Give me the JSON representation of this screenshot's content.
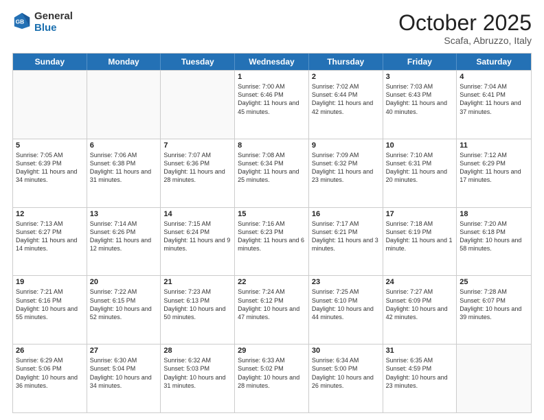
{
  "header": {
    "logo_general": "General",
    "logo_blue": "Blue",
    "month": "October 2025",
    "location": "Scafa, Abruzzo, Italy"
  },
  "weekdays": [
    "Sunday",
    "Monday",
    "Tuesday",
    "Wednesday",
    "Thursday",
    "Friday",
    "Saturday"
  ],
  "rows": [
    [
      {
        "date": "",
        "info": ""
      },
      {
        "date": "",
        "info": ""
      },
      {
        "date": "",
        "info": ""
      },
      {
        "date": "1",
        "info": "Sunrise: 7:00 AM\nSunset: 6:46 PM\nDaylight: 11 hours and 45 minutes."
      },
      {
        "date": "2",
        "info": "Sunrise: 7:02 AM\nSunset: 6:44 PM\nDaylight: 11 hours and 42 minutes."
      },
      {
        "date": "3",
        "info": "Sunrise: 7:03 AM\nSunset: 6:43 PM\nDaylight: 11 hours and 40 minutes."
      },
      {
        "date": "4",
        "info": "Sunrise: 7:04 AM\nSunset: 6:41 PM\nDaylight: 11 hours and 37 minutes."
      }
    ],
    [
      {
        "date": "5",
        "info": "Sunrise: 7:05 AM\nSunset: 6:39 PM\nDaylight: 11 hours and 34 minutes."
      },
      {
        "date": "6",
        "info": "Sunrise: 7:06 AM\nSunset: 6:38 PM\nDaylight: 11 hours and 31 minutes."
      },
      {
        "date": "7",
        "info": "Sunrise: 7:07 AM\nSunset: 6:36 PM\nDaylight: 11 hours and 28 minutes."
      },
      {
        "date": "8",
        "info": "Sunrise: 7:08 AM\nSunset: 6:34 PM\nDaylight: 11 hours and 25 minutes."
      },
      {
        "date": "9",
        "info": "Sunrise: 7:09 AM\nSunset: 6:32 PM\nDaylight: 11 hours and 23 minutes."
      },
      {
        "date": "10",
        "info": "Sunrise: 7:10 AM\nSunset: 6:31 PM\nDaylight: 11 hours and 20 minutes."
      },
      {
        "date": "11",
        "info": "Sunrise: 7:12 AM\nSunset: 6:29 PM\nDaylight: 11 hours and 17 minutes."
      }
    ],
    [
      {
        "date": "12",
        "info": "Sunrise: 7:13 AM\nSunset: 6:27 PM\nDaylight: 11 hours and 14 minutes."
      },
      {
        "date": "13",
        "info": "Sunrise: 7:14 AM\nSunset: 6:26 PM\nDaylight: 11 hours and 12 minutes."
      },
      {
        "date": "14",
        "info": "Sunrise: 7:15 AM\nSunset: 6:24 PM\nDaylight: 11 hours and 9 minutes."
      },
      {
        "date": "15",
        "info": "Sunrise: 7:16 AM\nSunset: 6:23 PM\nDaylight: 11 hours and 6 minutes."
      },
      {
        "date": "16",
        "info": "Sunrise: 7:17 AM\nSunset: 6:21 PM\nDaylight: 11 hours and 3 minutes."
      },
      {
        "date": "17",
        "info": "Sunrise: 7:18 AM\nSunset: 6:19 PM\nDaylight: 11 hours and 1 minute."
      },
      {
        "date": "18",
        "info": "Sunrise: 7:20 AM\nSunset: 6:18 PM\nDaylight: 10 hours and 58 minutes."
      }
    ],
    [
      {
        "date": "19",
        "info": "Sunrise: 7:21 AM\nSunset: 6:16 PM\nDaylight: 10 hours and 55 minutes."
      },
      {
        "date": "20",
        "info": "Sunrise: 7:22 AM\nSunset: 6:15 PM\nDaylight: 10 hours and 52 minutes."
      },
      {
        "date": "21",
        "info": "Sunrise: 7:23 AM\nSunset: 6:13 PM\nDaylight: 10 hours and 50 minutes."
      },
      {
        "date": "22",
        "info": "Sunrise: 7:24 AM\nSunset: 6:12 PM\nDaylight: 10 hours and 47 minutes."
      },
      {
        "date": "23",
        "info": "Sunrise: 7:25 AM\nSunset: 6:10 PM\nDaylight: 10 hours and 44 minutes."
      },
      {
        "date": "24",
        "info": "Sunrise: 7:27 AM\nSunset: 6:09 PM\nDaylight: 10 hours and 42 minutes."
      },
      {
        "date": "25",
        "info": "Sunrise: 7:28 AM\nSunset: 6:07 PM\nDaylight: 10 hours and 39 minutes."
      }
    ],
    [
      {
        "date": "26",
        "info": "Sunrise: 6:29 AM\nSunset: 5:06 PM\nDaylight: 10 hours and 36 minutes."
      },
      {
        "date": "27",
        "info": "Sunrise: 6:30 AM\nSunset: 5:04 PM\nDaylight: 10 hours and 34 minutes."
      },
      {
        "date": "28",
        "info": "Sunrise: 6:32 AM\nSunset: 5:03 PM\nDaylight: 10 hours and 31 minutes."
      },
      {
        "date": "29",
        "info": "Sunrise: 6:33 AM\nSunset: 5:02 PM\nDaylight: 10 hours and 28 minutes."
      },
      {
        "date": "30",
        "info": "Sunrise: 6:34 AM\nSunset: 5:00 PM\nDaylight: 10 hours and 26 minutes."
      },
      {
        "date": "31",
        "info": "Sunrise: 6:35 AM\nSunset: 4:59 PM\nDaylight: 10 hours and 23 minutes."
      },
      {
        "date": "",
        "info": ""
      }
    ]
  ]
}
